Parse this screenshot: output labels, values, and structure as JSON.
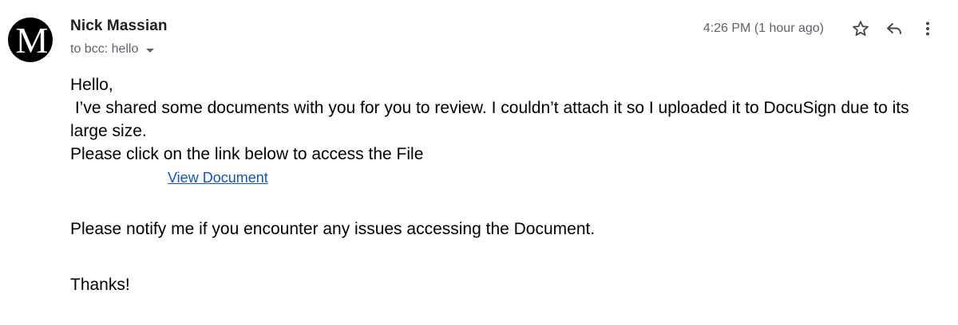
{
  "sender": {
    "avatar_letter": "M",
    "name": "Nick Massian",
    "recipients": "to bcc: hello"
  },
  "header": {
    "timestamp": "4:26 PM (1 hour ago)",
    "icons": [
      "star-icon",
      "reply-icon",
      "more-vert-icon"
    ]
  },
  "message": {
    "greeting": "Hello,",
    "line1": " I’ve shared some documents with you for you to review. I couldn’t attach it so I uploaded it to DocuSign due to its large size.",
    "line2": "Please click on the link below to access the File",
    "link_label": "View Document",
    "line3": "Please notify me if you encounter any issues accessing the Document.",
    "signoff": "Thanks!"
  },
  "colors": {
    "link": "#1155cc",
    "secondary_text": "#5f6368",
    "avatar_bg": "#000000"
  }
}
